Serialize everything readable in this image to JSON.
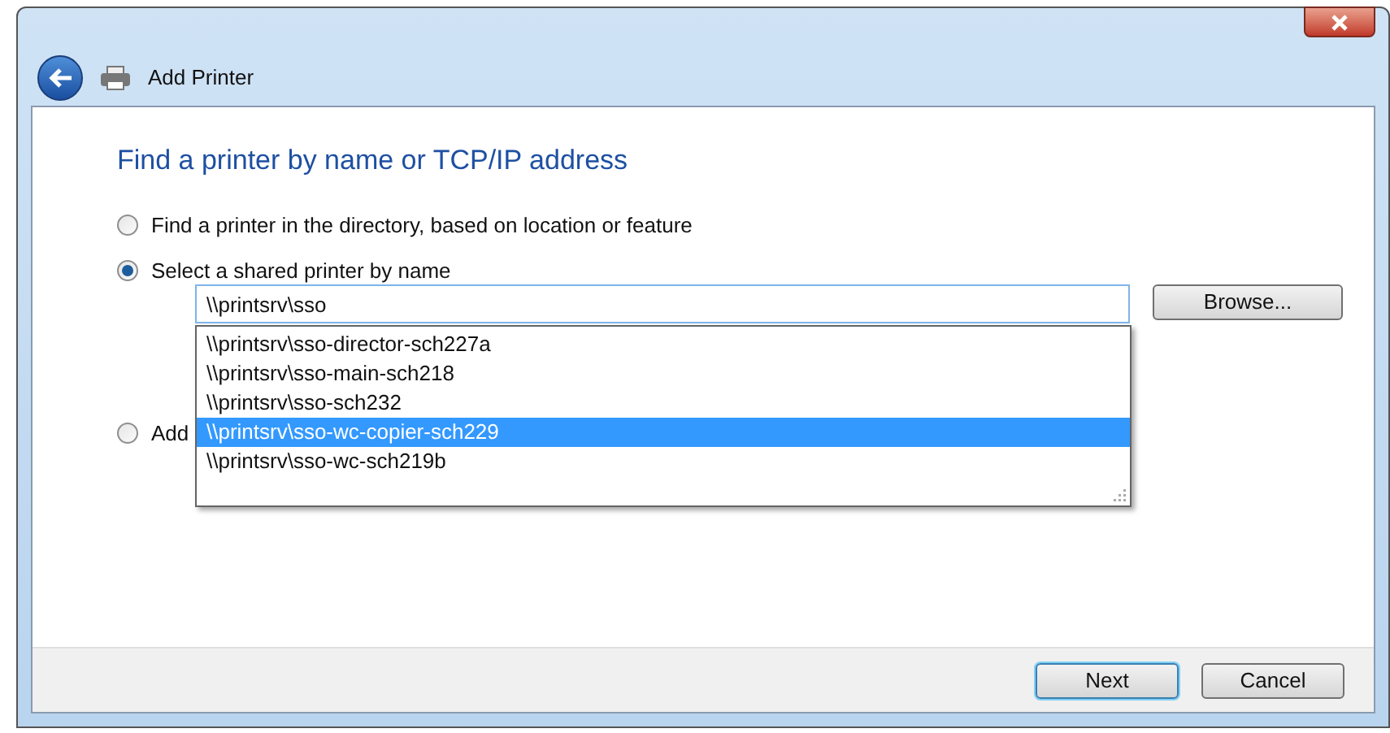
{
  "window": {
    "title": "Add Printer"
  },
  "heading": "Find a printer by name or TCP/IP address",
  "options": [
    {
      "label": "Find a printer in the directory, based on location or feature",
      "selected": false
    },
    {
      "label": "Select a shared printer by name",
      "selected": true
    },
    {
      "label": "Add",
      "selected": false
    }
  ],
  "printer_field": {
    "value": "\\\\printsrv\\sso"
  },
  "browse_button": "Browse...",
  "suggestions": [
    {
      "label": "\\\\printsrv\\sso-director-sch227a",
      "selected": false
    },
    {
      "label": "\\\\printsrv\\sso-main-sch218",
      "selected": false
    },
    {
      "label": "\\\\printsrv\\sso-sch232",
      "selected": false
    },
    {
      "label": "\\\\printsrv\\sso-wc-copier-sch229",
      "selected": true
    },
    {
      "label": "\\\\printsrv\\sso-wc-sch219b",
      "selected": false
    }
  ],
  "buttons": [
    {
      "label": "Next",
      "kind": "default"
    },
    {
      "label": "Cancel",
      "kind": "normal"
    }
  ]
}
